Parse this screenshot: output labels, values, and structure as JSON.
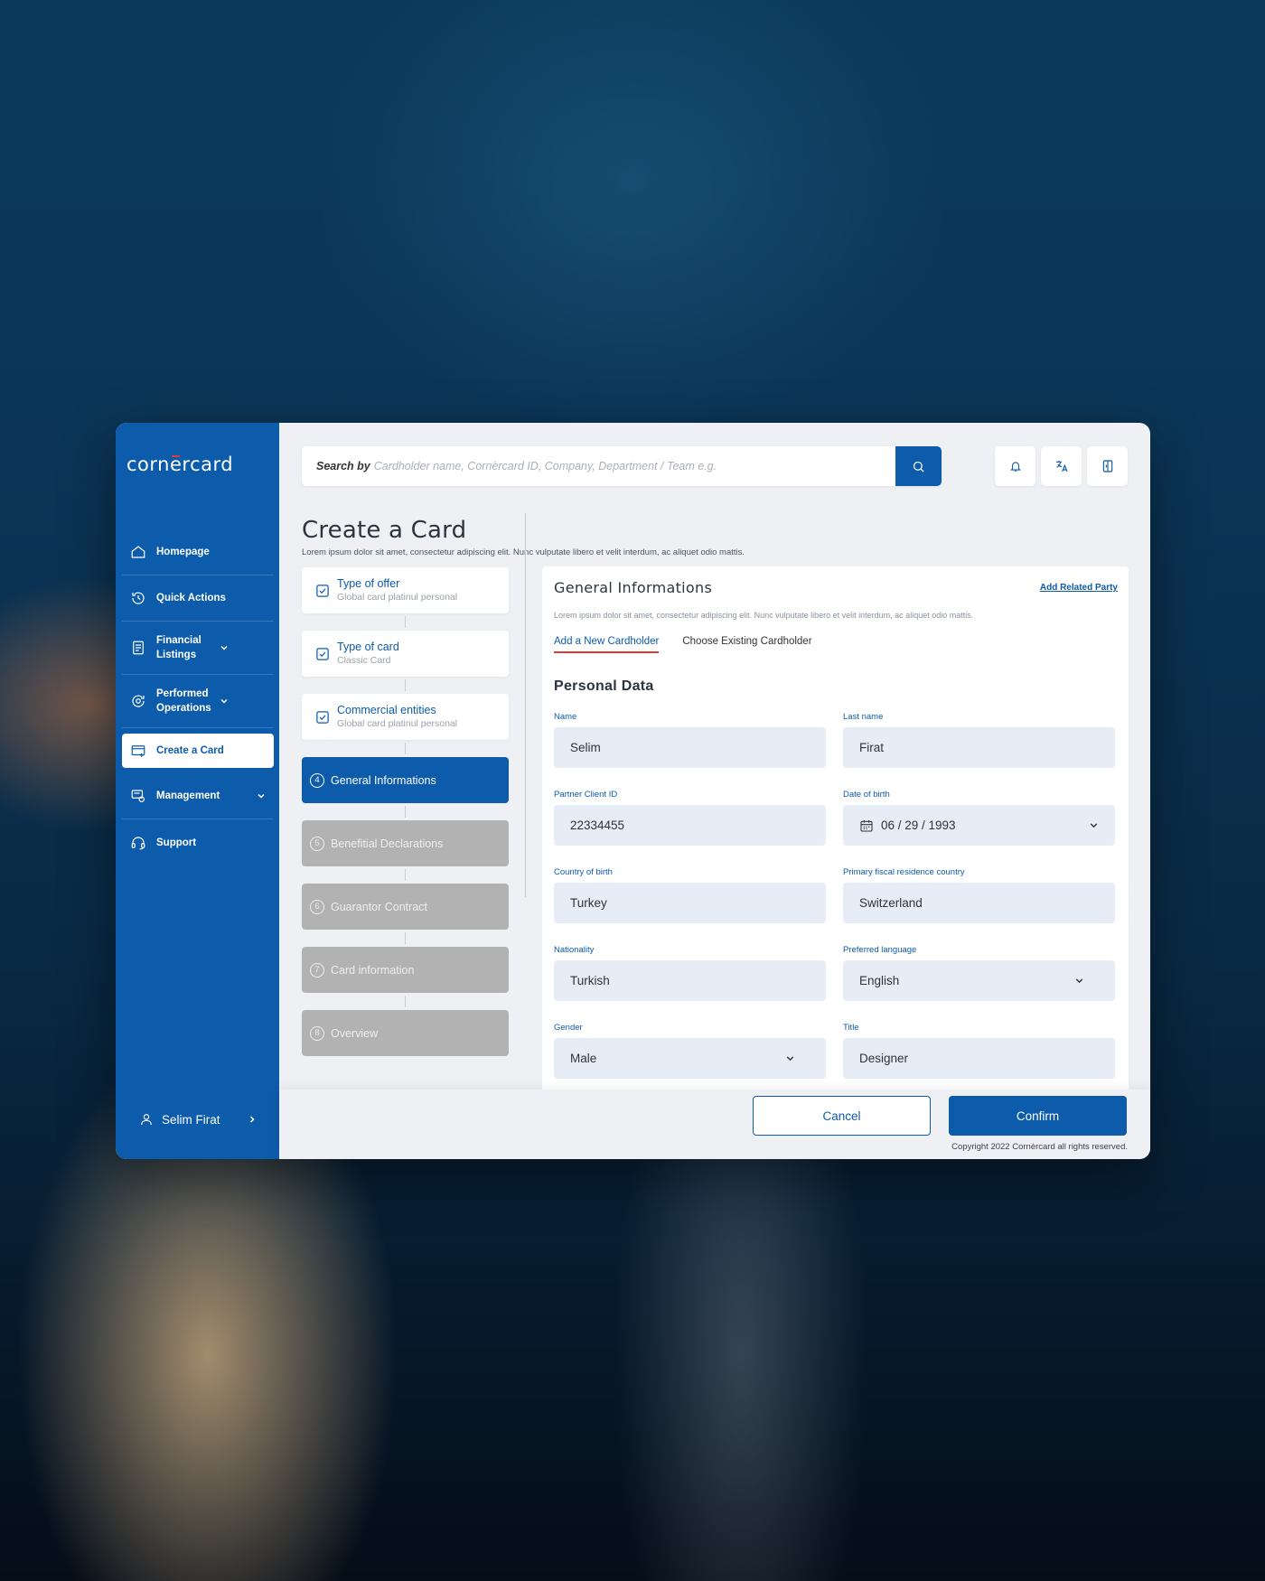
{
  "brand": {
    "logo": "cornercard"
  },
  "sidebar": {
    "items": [
      {
        "label": "Homepage",
        "icon": "home-icon"
      },
      {
        "label": "Quick Actions",
        "icon": "history-icon"
      },
      {
        "label": "Financial Listings",
        "icon": "list-icon",
        "expandable": true
      },
      {
        "label": "Performed Operations",
        "icon": "refresh-icon",
        "expandable": true
      },
      {
        "label": "Create a Card",
        "icon": "card-plus-icon",
        "active": true
      },
      {
        "label": "Management",
        "icon": "management-icon",
        "expandable": true
      },
      {
        "label": "Support",
        "icon": "headset-icon"
      }
    ],
    "user": {
      "name": "Selim Firat"
    }
  },
  "search": {
    "label": "Search by",
    "placeholder": "Cardholder name, Cornèrcard ID, Company, Department / Team e.g."
  },
  "page": {
    "title": "Create a Card",
    "subtitle": "Lorem ipsum dolor sit amet, consectetur adipiscing elit. Nunc vulputate libero et velit interdum, ac aliquet odio mattis."
  },
  "steps": {
    "done": [
      {
        "title": "Type of offer",
        "sub": "Global card platinul personal"
      },
      {
        "title": "Type of card",
        "sub": "Classic Card"
      },
      {
        "title": "Commercial entities",
        "sub": "Global card platinul personal"
      }
    ],
    "active": {
      "num": "4",
      "label": "General Informations"
    },
    "pending": [
      {
        "num": "5",
        "label": "Benefitial Declarations"
      },
      {
        "num": "6",
        "label": "Guarantor Contract"
      },
      {
        "num": "7",
        "label": "Card information"
      },
      {
        "num": "8",
        "label": "Overview"
      }
    ]
  },
  "panel": {
    "title": "General Informations",
    "related_link": "Add Related Party",
    "subtitle": "Lorem ipsum dolor sit amet, consectetur adipiscing elit. Nunc vulputate libero et velit interdum, ac aliquet odio mattis.",
    "tabs": [
      "Add a New Cardholder",
      "Choose Existing Cardholder"
    ],
    "section_title": "Personal Data",
    "fields": {
      "name": {
        "label": "Name",
        "value": "Selim"
      },
      "last_name": {
        "label": "Last name",
        "value": "Firat"
      },
      "partner_id": {
        "label": "Partner Client ID",
        "value": "22334455"
      },
      "dob": {
        "label": "Date of birth",
        "value": "06 / 29 / 1993"
      },
      "country_birth": {
        "label": "Country of birth",
        "value": "Turkey"
      },
      "fiscal_country": {
        "label": "Primary fiscal residence country",
        "value": "Switzerland"
      },
      "nationality": {
        "label": "Nationality",
        "value": "Turkish"
      },
      "language": {
        "label": "Preferred language",
        "value": "English"
      },
      "gender": {
        "label": "Gender",
        "value": "Male"
      },
      "title": {
        "label": "Title",
        "value": "Designer"
      }
    }
  },
  "footer": {
    "cancel": "Cancel",
    "confirm": "Confirm",
    "copyright": "Copyright 2022 Cornèrcard all rights reserved."
  },
  "colors": {
    "brand": "#0d5bab",
    "accent": "#e53935",
    "field_bg": "#e6edf6",
    "pending": "#b2b2b2"
  }
}
